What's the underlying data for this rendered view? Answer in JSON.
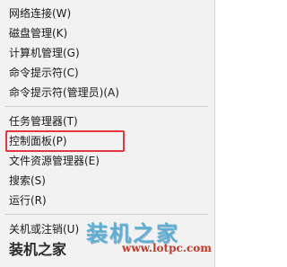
{
  "menu": {
    "items": [
      {
        "label": "网络连接(W)"
      },
      {
        "label": "磁盘管理(K)"
      },
      {
        "label": "计算机管理(G)"
      },
      {
        "label": "命令提示符(C)"
      },
      {
        "label": "命令提示符(管理员)(A)"
      },
      {
        "label": "任务管理器(T)"
      },
      {
        "label": "控制面板(P)"
      },
      {
        "label": "文件资源管理器(E)"
      },
      {
        "label": "搜索(S)"
      },
      {
        "label": "运行(R)"
      },
      {
        "label": "关机或注销(U)"
      }
    ],
    "highlighted_item": "控制面板(P)",
    "highlight_color": "#e8373a"
  },
  "watermark": {
    "main": "装机之家",
    "brand": "装机之家",
    "url": "www.lotpc.com"
  }
}
